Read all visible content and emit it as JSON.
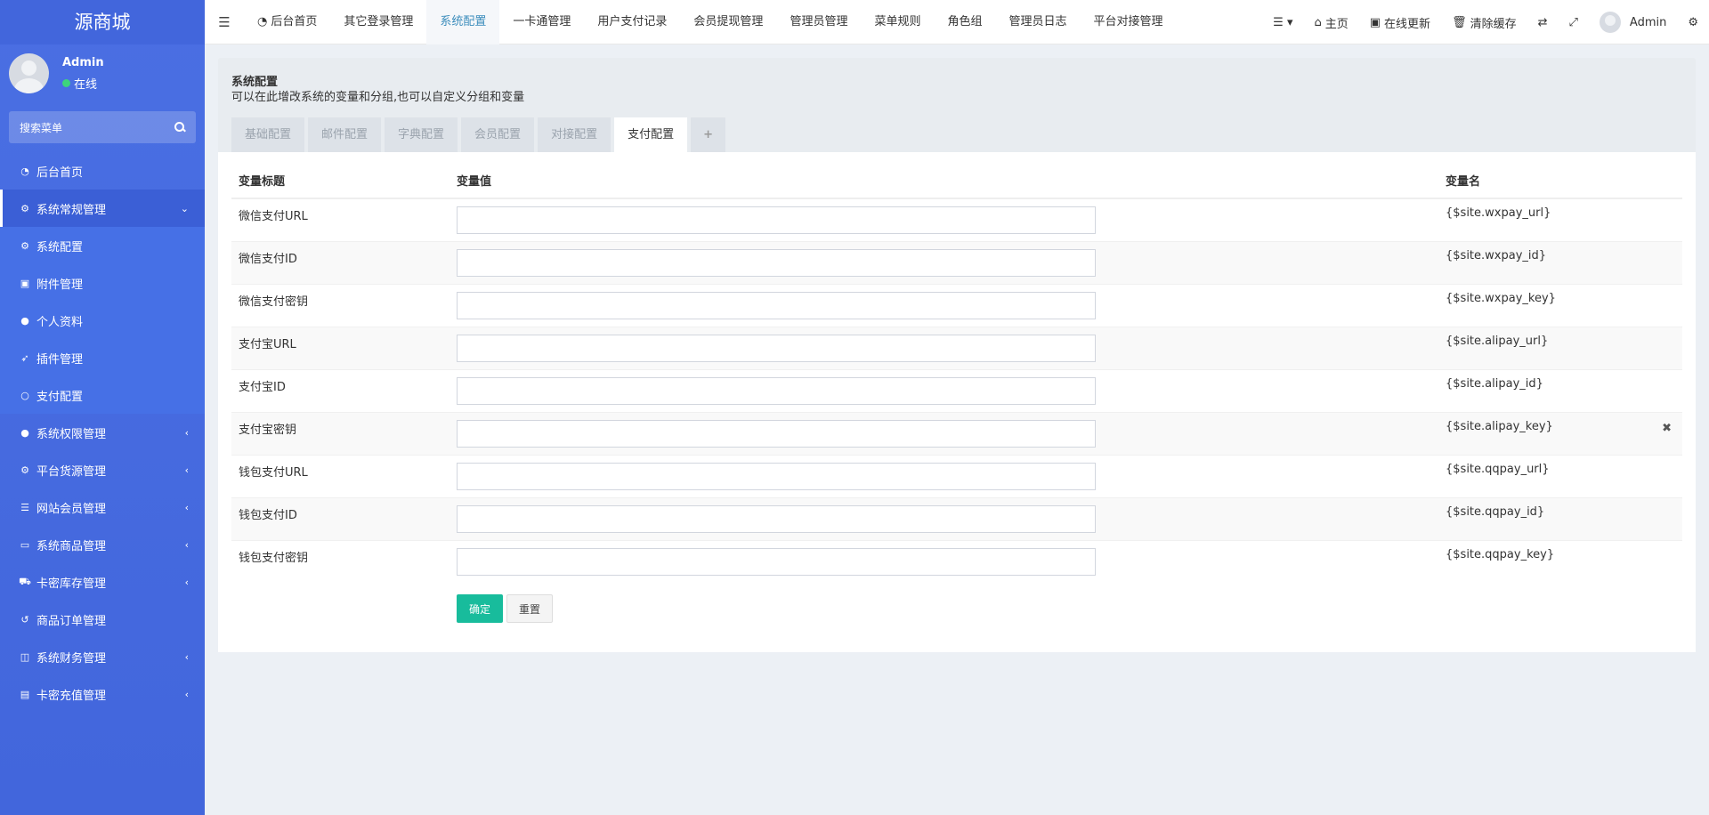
{
  "app": {
    "logo": "源商城"
  },
  "user": {
    "name": "Admin",
    "status": "在线"
  },
  "sidebar": {
    "search_placeholder": "搜索菜单",
    "items": [
      {
        "label": "后台首页",
        "icon": "dashboard-icon",
        "glyph": "◔",
        "arrow": ""
      },
      {
        "label": "系统常规管理",
        "icon": "cogs-icon",
        "glyph": "⚙",
        "arrow": "⌄"
      },
      {
        "label": "系统配置",
        "icon": "gear-icon",
        "glyph": "⚙",
        "arrow": ""
      },
      {
        "label": "附件管理",
        "icon": "file-image-icon",
        "glyph": "▣",
        "arrow": ""
      },
      {
        "label": "个人资料",
        "icon": "user-icon",
        "glyph": "●",
        "arrow": ""
      },
      {
        "label": "插件管理",
        "icon": "rocket-icon",
        "glyph": "➶",
        "arrow": ""
      },
      {
        "label": "支付配置",
        "icon": "circle-icon",
        "glyph": "○",
        "arrow": ""
      },
      {
        "label": "系统权限管理",
        "icon": "group-icon",
        "glyph": "●",
        "arrow": "‹"
      },
      {
        "label": "平台货源管理",
        "icon": "cogs-icon",
        "glyph": "⚙",
        "arrow": "‹"
      },
      {
        "label": "网站会员管理",
        "icon": "list-icon",
        "glyph": "☰",
        "arrow": "‹"
      },
      {
        "label": "系统商品管理",
        "icon": "keyboard-icon",
        "glyph": "▭",
        "arrow": "‹"
      },
      {
        "label": "卡密库存管理",
        "icon": "cart-icon",
        "glyph": "⛟",
        "arrow": "‹"
      },
      {
        "label": "商品订单管理",
        "icon": "history-icon",
        "glyph": "↺",
        "arrow": ""
      },
      {
        "label": "系统财务管理",
        "icon": "binoculars-icon",
        "glyph": "◫",
        "arrow": "‹"
      },
      {
        "label": "卡密充值管理",
        "icon": "money-icon",
        "glyph": "▤",
        "arrow": "‹"
      }
    ]
  },
  "topnav": {
    "tabs": [
      "后台首页",
      "其它登录管理",
      "系统配置",
      "一卡通管理",
      "用户支付记录",
      "会员提现管理",
      "管理员管理",
      "菜单规则",
      "角色组",
      "管理员日志",
      "平台对接管理"
    ],
    "right": {
      "home": "主页",
      "update": "在线更新",
      "clear": "清除缓存",
      "admin": "Admin"
    }
  },
  "panel": {
    "title": "系统配置",
    "description": "可以在此增改系统的变量和分组,也可以自定义分组和变量",
    "tabs": [
      "基础配置",
      "邮件配置",
      "字典配置",
      "会员配置",
      "对接配置",
      "支付配置"
    ],
    "add_tab": "+"
  },
  "table": {
    "headers": [
      "变量标题",
      "变量值",
      "变量名"
    ],
    "rows": [
      {
        "title": "微信支付URL",
        "value": "",
        "name": "{$site.wxpay_url}"
      },
      {
        "title": "微信支付ID",
        "value": "",
        "name": "{$site.wxpay_id}"
      },
      {
        "title": "微信支付密钥",
        "value": "",
        "name": "{$site.wxpay_key}"
      },
      {
        "title": "支付宝URL",
        "value": "",
        "name": "{$site.alipay_url}"
      },
      {
        "title": "支付宝ID",
        "value": "",
        "name": "{$site.alipay_id}"
      },
      {
        "title": "支付宝密钥",
        "value": "",
        "name": "{$site.alipay_key}"
      },
      {
        "title": "钱包支付URL",
        "value": "",
        "name": "{$site.qqpay_url}"
      },
      {
        "title": "钱包支付ID",
        "value": "",
        "name": "{$site.qqpay_id}"
      },
      {
        "title": "钱包支付密钥",
        "value": "",
        "name": "{$site.qqpay_key}"
      }
    ]
  },
  "buttons": {
    "submit": "确定",
    "reset": "重置"
  }
}
